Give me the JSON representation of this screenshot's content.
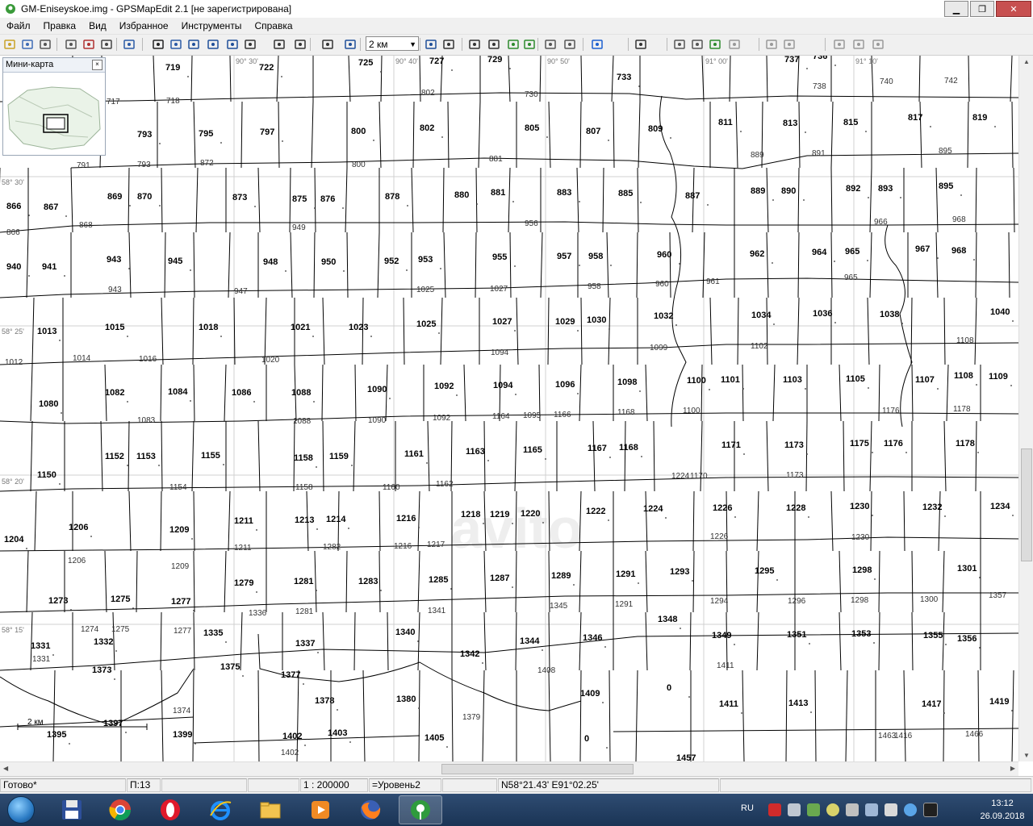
{
  "window": {
    "title": "GM-Eniseyskoe.img - GPSMapEdit 2.1 [не зарегистрирована]",
    "buttons": [
      "minimize",
      "maximize",
      "close"
    ]
  },
  "menu": [
    "Файл",
    "Правка",
    "Вид",
    "Избранное",
    "Инструменты",
    "Справка"
  ],
  "toolbar": {
    "scale_value": "2 км",
    "icons": [
      "open-icon",
      "save-icon",
      "properties-icon",
      "print-icon",
      "route-icon",
      "hand-pan-icon",
      "zoom-rect-icon",
      "select-arrow-icon",
      "select-objects-icon",
      "edit-nodes-icon",
      "polyline-icon",
      "add-points-icon",
      "select-rect-icon",
      "transform-icon",
      "move-icon",
      "label-icon",
      "zoom-in-icon",
      "zoom-out-icon",
      "label-ab-icon",
      "measure-icon",
      "grid-icon",
      "track-icon",
      "waypoint-icon",
      "map-icon",
      "routing-icon",
      "google-icon",
      "layers-icon",
      "page-icon",
      "coords-icon",
      "gps-icon",
      "undo-icon",
      "redo-icon",
      "cut-icon",
      "copy-icon",
      "paste-icon",
      "delete-icon"
    ]
  },
  "minimap": {
    "title": "Мини-карта"
  },
  "map": {
    "watermark": "avito",
    "scale_bar_label": "2 км",
    "grid_labels": [
      {
        "id": "g1",
        "text": "90° 30'"
      },
      {
        "id": "g2",
        "text": "90° 40'"
      },
      {
        "id": "g3",
        "text": "90° 50'"
      },
      {
        "id": "g4",
        "text": "91° 00'"
      },
      {
        "id": "g5",
        "text": "91° 10'"
      },
      {
        "id": "g6",
        "text": "58° 30'"
      },
      {
        "id": "g7",
        "text": "58° 25'"
      },
      {
        "id": "g8",
        "text": "58° 20'"
      },
      {
        "id": "g9",
        "text": "58° 15'"
      }
    ],
    "bold_labels": [
      {
        "t": "719"
      },
      {
        "t": "722"
      },
      {
        "t": "725"
      },
      {
        "t": "727"
      },
      {
        "t": "729"
      },
      {
        "t": "733"
      },
      {
        "t": "737"
      },
      {
        "t": "736"
      },
      {
        "t": "793"
      },
      {
        "t": "795"
      },
      {
        "t": "797"
      },
      {
        "t": "800"
      },
      {
        "t": "802"
      },
      {
        "t": "805"
      },
      {
        "t": "807"
      },
      {
        "t": "809"
      },
      {
        "t": "811"
      },
      {
        "t": "813"
      },
      {
        "t": "815"
      },
      {
        "t": "817"
      },
      {
        "t": "819"
      },
      {
        "t": "866"
      },
      {
        "t": "867"
      },
      {
        "t": "869"
      },
      {
        "t": "870"
      },
      {
        "t": "873"
      },
      {
        "t": "875"
      },
      {
        "t": "876"
      },
      {
        "t": "878"
      },
      {
        "t": "880"
      },
      {
        "t": "881"
      },
      {
        "t": "883"
      },
      {
        "t": "885"
      },
      {
        "t": "887"
      },
      {
        "t": "889"
      },
      {
        "t": "890"
      },
      {
        "t": "892"
      },
      {
        "t": "893"
      },
      {
        "t": "895"
      },
      {
        "t": "940"
      },
      {
        "t": "941"
      },
      {
        "t": "943"
      },
      {
        "t": "945"
      },
      {
        "t": "948"
      },
      {
        "t": "950"
      },
      {
        "t": "952"
      },
      {
        "t": "953"
      },
      {
        "t": "955"
      },
      {
        "t": "957"
      },
      {
        "t": "958"
      },
      {
        "t": "960"
      },
      {
        "t": "962"
      },
      {
        "t": "964"
      },
      {
        "t": "965"
      },
      {
        "t": "967"
      },
      {
        "t": "968"
      },
      {
        "t": "1013"
      },
      {
        "t": "1015"
      },
      {
        "t": "1018"
      },
      {
        "t": "1021"
      },
      {
        "t": "1023"
      },
      {
        "t": "1025"
      },
      {
        "t": "1027"
      },
      {
        "t": "1029"
      },
      {
        "t": "1030"
      },
      {
        "t": "1032"
      },
      {
        "t": "1034"
      },
      {
        "t": "1036"
      },
      {
        "t": "1038"
      },
      {
        "t": "1040"
      },
      {
        "t": "1080"
      },
      {
        "t": "1082"
      },
      {
        "t": "1084"
      },
      {
        "t": "1086"
      },
      {
        "t": "1088"
      },
      {
        "t": "1090"
      },
      {
        "t": "1092"
      },
      {
        "t": "1094"
      },
      {
        "t": "1096"
      },
      {
        "t": "1098"
      },
      {
        "t": "1100"
      },
      {
        "t": "1101"
      },
      {
        "t": "1103"
      },
      {
        "t": "1105"
      },
      {
        "t": "1107"
      },
      {
        "t": "1108"
      },
      {
        "t": "1109"
      },
      {
        "t": "1150"
      },
      {
        "t": "1152"
      },
      {
        "t": "1153"
      },
      {
        "t": "1155"
      },
      {
        "t": "1158"
      },
      {
        "t": "1159"
      },
      {
        "t": "1161"
      },
      {
        "t": "1163"
      },
      {
        "t": "1165"
      },
      {
        "t": "1167"
      },
      {
        "t": "1168"
      },
      {
        "t": "1171"
      },
      {
        "t": "1173"
      },
      {
        "t": "1175"
      },
      {
        "t": "1176"
      },
      {
        "t": "1178"
      },
      {
        "t": "1204"
      },
      {
        "t": "1206"
      },
      {
        "t": "1209"
      },
      {
        "t": "1211"
      },
      {
        "t": "1213"
      },
      {
        "t": "1214"
      },
      {
        "t": "1216"
      },
      {
        "t": "1218"
      },
      {
        "t": "1219"
      },
      {
        "t": "1220"
      },
      {
        "t": "1222"
      },
      {
        "t": "1224"
      },
      {
        "t": "1226"
      },
      {
        "t": "1228"
      },
      {
        "t": "1230"
      },
      {
        "t": "1232"
      },
      {
        "t": "1234"
      },
      {
        "t": "1279"
      },
      {
        "t": "1281"
      },
      {
        "t": "1283"
      },
      {
        "t": "1285"
      },
      {
        "t": "1287"
      },
      {
        "t": "1289"
      },
      {
        "t": "1291"
      },
      {
        "t": "1293"
      },
      {
        "t": "1295"
      },
      {
        "t": "1298"
      },
      {
        "t": "1301"
      },
      {
        "t": "1273"
      },
      {
        "t": "1275"
      },
      {
        "t": "1277"
      },
      {
        "t": "1335"
      },
      {
        "t": "1337"
      },
      {
        "t": "1340"
      },
      {
        "t": "1342"
      },
      {
        "t": "1344"
      },
      {
        "t": "1346"
      },
      {
        "t": "1348"
      },
      {
        "t": "1349"
      },
      {
        "t": "1351"
      },
      {
        "t": "1353"
      },
      {
        "t": "1355"
      },
      {
        "t": "1356"
      },
      {
        "t": "1331"
      },
      {
        "t": "1332"
      },
      {
        "t": "1373"
      },
      {
        "t": "1375"
      },
      {
        "t": "1377"
      },
      {
        "t": "1378"
      },
      {
        "t": "1380"
      },
      {
        "t": "1409"
      },
      {
        "t": "0"
      },
      {
        "t": "1411"
      },
      {
        "t": "1413"
      },
      {
        "t": "1417"
      },
      {
        "t": "1419"
      },
      {
        "t": "1395"
      },
      {
        "t": "1397"
      },
      {
        "t": "1399"
      },
      {
        "t": "1402"
      },
      {
        "t": "1403"
      },
      {
        "t": "1405"
      },
      {
        "t": "0"
      },
      {
        "t": "1457"
      }
    ],
    "thin_labels": [
      {
        "t": "717"
      },
      {
        "t": "718"
      },
      {
        "t": "802"
      },
      {
        "t": "730"
      },
      {
        "t": "738"
      },
      {
        "t": "740"
      },
      {
        "t": "742"
      },
      {
        "t": "791"
      },
      {
        "t": "793"
      },
      {
        "t": "872"
      },
      {
        "t": "800"
      },
      {
        "t": "881"
      },
      {
        "t": "889"
      },
      {
        "t": "891"
      },
      {
        "t": "895"
      },
      {
        "t": "866"
      },
      {
        "t": "868"
      },
      {
        "t": "949"
      },
      {
        "t": "956"
      },
      {
        "t": "966"
      },
      {
        "t": "968"
      },
      {
        "t": "943"
      },
      {
        "t": "947"
      },
      {
        "t": "1025"
      },
      {
        "t": "1027"
      },
      {
        "t": "958"
      },
      {
        "t": "960"
      },
      {
        "t": "961"
      },
      {
        "t": "965"
      },
      {
        "t": "1012"
      },
      {
        "t": "1014"
      },
      {
        "t": "1016"
      },
      {
        "t": "1020"
      },
      {
        "t": "1094"
      },
      {
        "t": "1099"
      },
      {
        "t": "1102"
      },
      {
        "t": "1108"
      },
      {
        "t": "1083"
      },
      {
        "t": "1088"
      },
      {
        "t": "1090"
      },
      {
        "t": "1092"
      },
      {
        "t": "1164"
      },
      {
        "t": "1095"
      },
      {
        "t": "1166"
      },
      {
        "t": "1168"
      },
      {
        "t": "1100"
      },
      {
        "t": "1176"
      },
      {
        "t": "1178"
      },
      {
        "t": "1154"
      },
      {
        "t": "1158"
      },
      {
        "t": "1160"
      },
      {
        "t": "1162"
      },
      {
        "t": "1224"
      },
      {
        "t": "1170"
      },
      {
        "t": "1173"
      },
      {
        "t": "1211"
      },
      {
        "t": "1282"
      },
      {
        "t": "1216"
      },
      {
        "t": "1217"
      },
      {
        "t": "1226"
      },
      {
        "t": "1230"
      },
      {
        "t": "1206"
      },
      {
        "t": "1209"
      },
      {
        "t": "1336"
      },
      {
        "t": "1281"
      },
      {
        "t": "1341"
      },
      {
        "t": "1345"
      },
      {
        "t": "1291"
      },
      {
        "t": "1294"
      },
      {
        "t": "1296"
      },
      {
        "t": "1298"
      },
      {
        "t": "1300"
      },
      {
        "t": "1357"
      },
      {
        "t": "1274"
      },
      {
        "t": "1275"
      },
      {
        "t": "1277"
      },
      {
        "t": "1331"
      },
      {
        "t": "1408"
      },
      {
        "t": "1411"
      },
      {
        "t": "1374"
      },
      {
        "t": "1379"
      },
      {
        "t": "1463"
      },
      {
        "t": "1416"
      },
      {
        "t": "1466"
      },
      {
        "t": "1402"
      }
    ]
  },
  "status": {
    "ready": "Готово*",
    "page": "П:13",
    "scale": "1 : 200000",
    "level": "=Уровень2",
    "coords": "N58°21.43' E91°02.25'"
  },
  "taskbar": {
    "apps": [
      "save-app-icon",
      "chrome-icon",
      "opera-icon",
      "ie-icon",
      "explorer-icon",
      "media-icon",
      "firefox-icon",
      "gpsmapedit-icon"
    ],
    "lang": "RU",
    "time": "13:12",
    "date": "26.09.2018"
  }
}
